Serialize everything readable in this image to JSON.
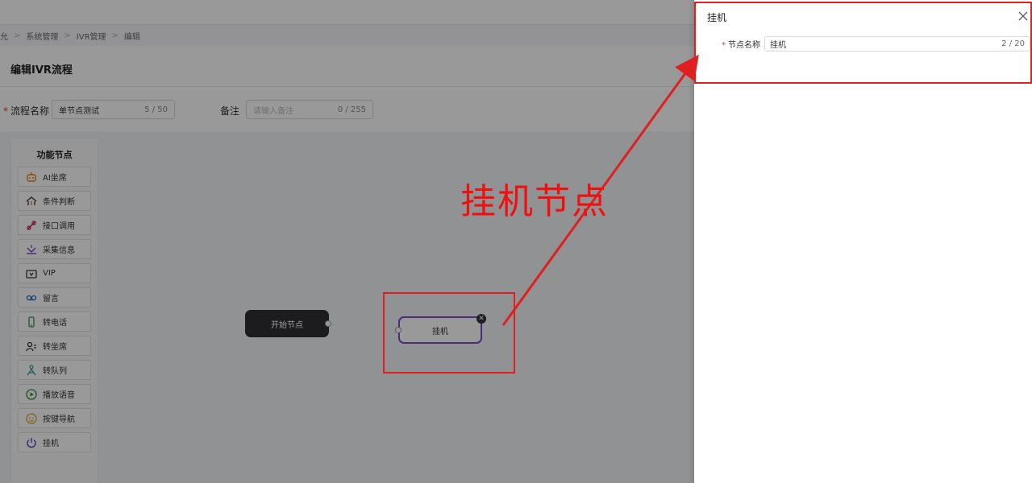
{
  "breadcrumb": {
    "items": [
      "允",
      "系统管理",
      "IVR管理",
      "编辑"
    ]
  },
  "page": {
    "title": "编辑IVR流程"
  },
  "form": {
    "flow_name": {
      "label": "流程名称",
      "value": "单节点测试",
      "count": "5 / 50"
    },
    "remark": {
      "label": "备注",
      "placeholder": "请输入备注",
      "count": "0 / 255"
    }
  },
  "palette": {
    "title": "功能节点",
    "items": [
      {
        "label": "AI坐席",
        "icon": "robot-icon"
      },
      {
        "label": "条件判断",
        "icon": "branch-icon"
      },
      {
        "label": "接口调用",
        "icon": "plug-icon"
      },
      {
        "label": "采集信息",
        "icon": "collect-icon"
      },
      {
        "label": "VIP",
        "icon": "vip-icon"
      },
      {
        "label": "留言",
        "icon": "voicemail-icon"
      },
      {
        "label": "转电话",
        "icon": "phone-icon"
      },
      {
        "label": "转坐席",
        "icon": "agent-icon"
      },
      {
        "label": "转队列",
        "icon": "queue-icon"
      },
      {
        "label": "播放语音",
        "icon": "play-icon"
      },
      {
        "label": "按键导航",
        "icon": "keypad-icon"
      },
      {
        "label": "挂机",
        "icon": "power-icon"
      }
    ]
  },
  "canvas": {
    "start_node": "开始节点",
    "hang_node": "挂机"
  },
  "drawer": {
    "title": "挂机",
    "field_label": "节点名称",
    "field_value": "挂机",
    "field_count": "2 / 20"
  },
  "annotation": {
    "text": "挂机节点",
    "color": "#ee1111"
  },
  "colors": {
    "node_border": "#7a4cc7",
    "required": "#e53935"
  }
}
